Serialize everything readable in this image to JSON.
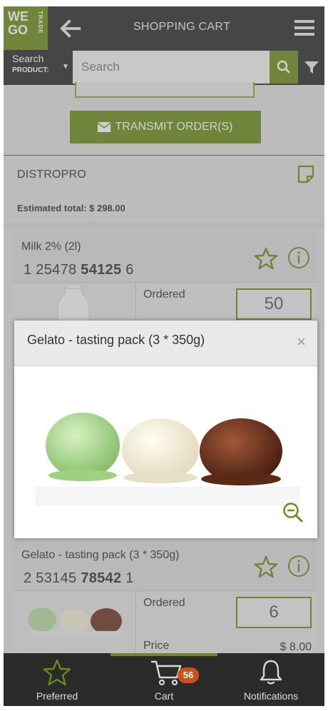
{
  "header": {
    "logo_line1": "WE",
    "logo_line2": "GO",
    "logo_side": "TRADE",
    "title": "SHOPPING CART"
  },
  "search": {
    "scope_line1": "Search",
    "scope_line2": "PRODUCT:",
    "placeholder": "Search"
  },
  "cart": {
    "transmit_label": "TRANSMIT ORDER(S)",
    "supplier": "DISTROPRO",
    "estimated_total": "Estimated total: $ 298.00"
  },
  "products": [
    {
      "name": "Milk 2% (2l)",
      "code_a": "1",
      "code_b": "25478",
      "code_c": "54125",
      "code_d": "6",
      "ordered_label": "Ordered",
      "ordered_qty": "50"
    },
    {
      "name": "Gelato - tasting pack (3 * 350g)",
      "code_a": "2",
      "code_b": "53145",
      "code_c": "78542",
      "code_d": "1",
      "ordered_label": "Ordered",
      "ordered_qty": "6",
      "price_label": "Price",
      "price": "$ 8.00"
    }
  ],
  "modal": {
    "title": "Gelato - tasting pack (3 * 350g)",
    "close": "×"
  },
  "tabs": {
    "preferred": "Preferred",
    "cart": "Cart",
    "cart_badge": "56",
    "notifications": "Notifications"
  },
  "colors": {
    "accent": "#6e8a1d",
    "dark": "#2b2b2b",
    "badge": "#c8521a"
  }
}
